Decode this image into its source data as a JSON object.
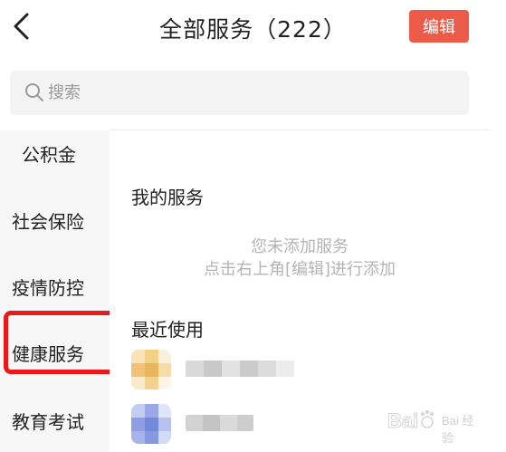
{
  "header": {
    "back_icon": "chevron-left-icon",
    "title": "全部服务（222）",
    "edit_label": "编辑",
    "edit_color": "#ec5b47"
  },
  "search": {
    "icon": "search-icon",
    "placeholder": "搜索"
  },
  "sidebar": {
    "items": [
      {
        "label": "公积金"
      },
      {
        "label": "社会保险"
      },
      {
        "label": "疫情防控"
      },
      {
        "label": "健康服务"
      },
      {
        "label": "教育考试"
      }
    ],
    "highlighted_item": "健康服务",
    "highlight_color": "#e8181b"
  },
  "content": {
    "my_services_title": "我的服务",
    "empty_line1": "您未添加服务",
    "empty_line2": "点击右上角[编辑]进行添加",
    "recent_title": "最近使用"
  },
  "watermark": {
    "text": "Bai 经验"
  }
}
